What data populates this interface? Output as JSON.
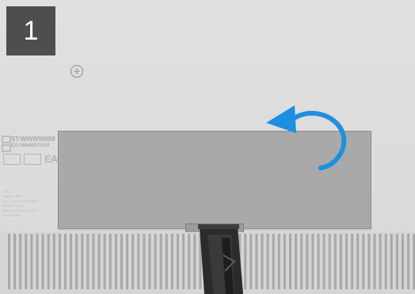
{
  "step": {
    "number": "1"
  },
  "sticker": {
    "line1": "ST:WWWW888",
    "line2": "EX:16946827XXX",
    "cert_mark": "EAC",
    "fine_print": [
      "DELL",
      "Inspiron 3552",
      "Reg. Type No. P32G008",
      "Made in China",
      "Regulatory Model P32G",
      "Input Rating"
    ]
  },
  "icons": {
    "step_badge": "step-number-badge",
    "screw": "screw-icon",
    "rotate_arrow": "curved-arrow-icon",
    "scribe": "plastic-scribe-icon"
  },
  "colors": {
    "base": "#dcdcdc",
    "cover_panel": "#a9a9a9",
    "badge": "#4e4e4e",
    "arrow": "#1e8fe0",
    "tool": "#2a2a2a"
  }
}
